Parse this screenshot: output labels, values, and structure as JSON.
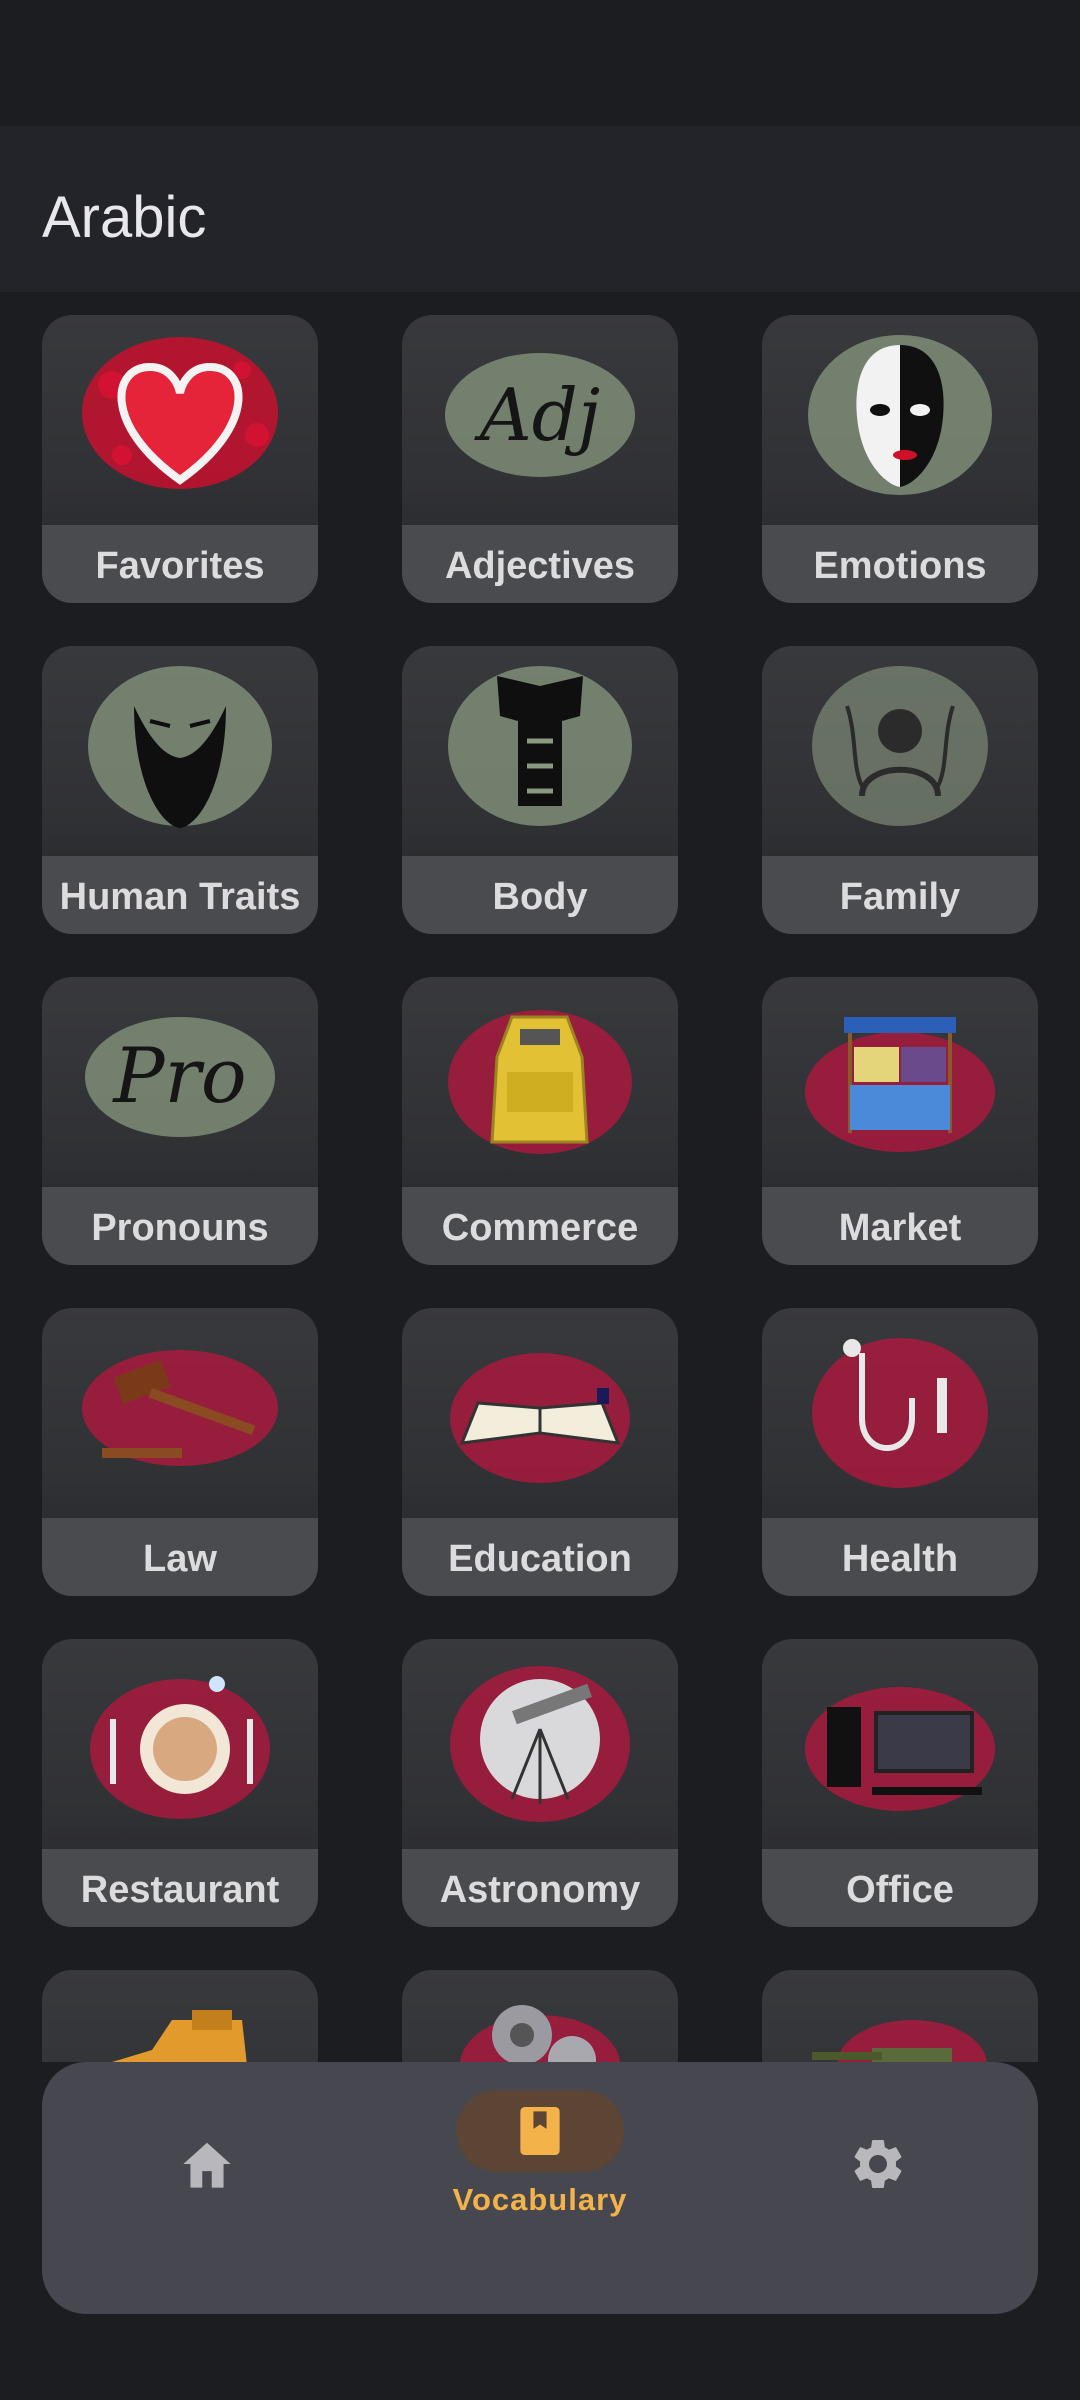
{
  "header": {
    "title": "Arabic"
  },
  "categories": [
    {
      "label": "Favorites",
      "icon": "heart-icon"
    },
    {
      "label": "Adjectives",
      "icon": "adj-text-icon"
    },
    {
      "label": "Emotions",
      "icon": "mask-icon"
    },
    {
      "label": "Human Traits",
      "icon": "face-icon"
    },
    {
      "label": "Body",
      "icon": "torso-icon"
    },
    {
      "label": "Family",
      "icon": "family-icon"
    },
    {
      "label": "Pronouns",
      "icon": "pro-text-icon"
    },
    {
      "label": "Commerce",
      "icon": "cash-register-icon"
    },
    {
      "label": "Market",
      "icon": "market-stall-icon"
    },
    {
      "label": "Law",
      "icon": "gavel-icon"
    },
    {
      "label": "Education",
      "icon": "book-icon"
    },
    {
      "label": "Health",
      "icon": "stethoscope-icon"
    },
    {
      "label": "Restaurant",
      "icon": "plate-icon"
    },
    {
      "label": "Astronomy",
      "icon": "telescope-icon"
    },
    {
      "label": "Office",
      "icon": "computer-icon"
    },
    {
      "label": "",
      "icon": "tractor-icon"
    },
    {
      "label": "",
      "icon": "gears-icon"
    },
    {
      "label": "",
      "icon": "tank-icon"
    }
  ],
  "nav": {
    "items": [
      {
        "label": "",
        "icon": "home-icon"
      },
      {
        "label": "Vocabulary",
        "icon": "book-icon"
      },
      {
        "label": "",
        "icon": "gear-icon"
      }
    ],
    "active_color": "#f4b34a",
    "inactive_color": "#b8b8bc"
  }
}
